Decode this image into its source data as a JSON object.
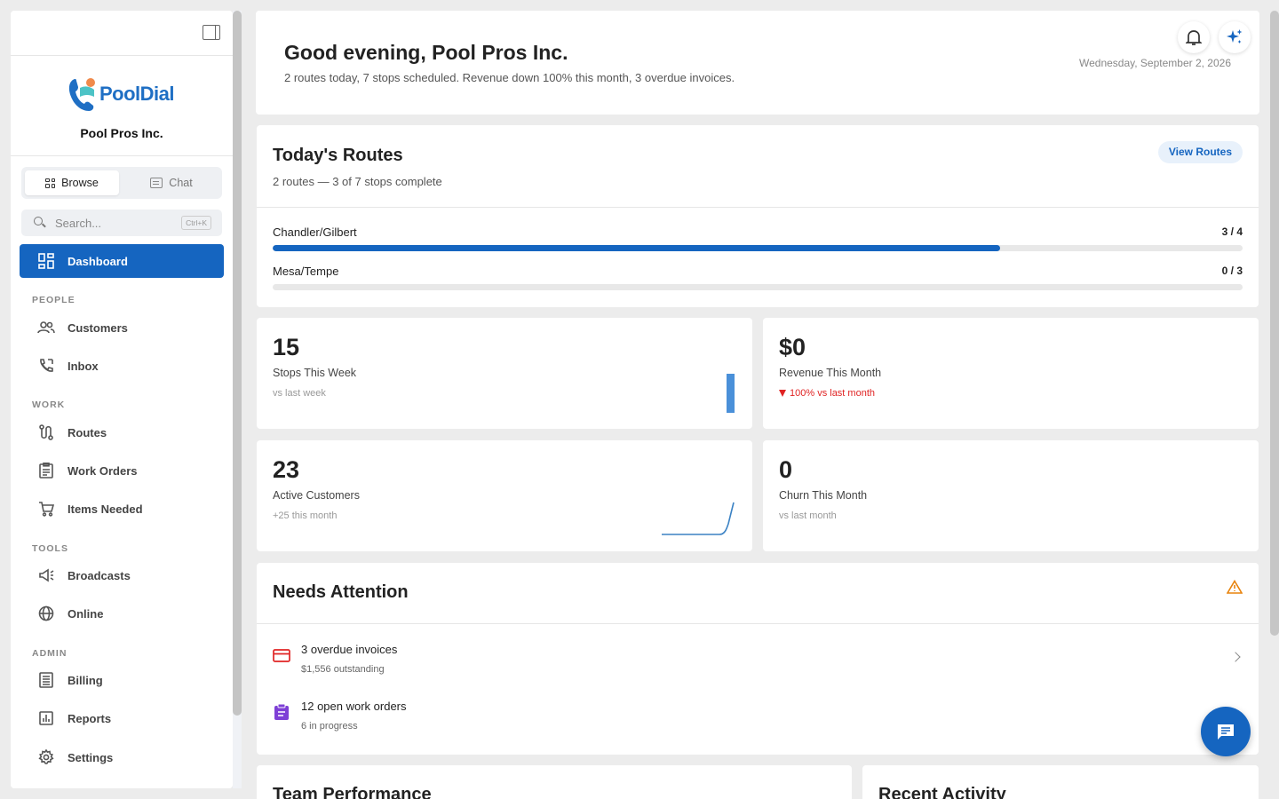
{
  "sidebar": {
    "brand_name": "PoolDial",
    "company": "Pool Pros Inc.",
    "modes": {
      "browse": "Browse",
      "chat": "Chat"
    },
    "search": {
      "placeholder": "Search...",
      "shortcut": "Ctrl+K"
    },
    "dashboard": "Dashboard",
    "sections": {
      "people": "PEOPLE",
      "work": "WORK",
      "tools": "TOOLS",
      "admin": "ADMIN"
    },
    "items": {
      "customers": "Customers",
      "inbox": "Inbox",
      "routes": "Routes",
      "work_orders": "Work Orders",
      "items_needed": "Items Needed",
      "broadcasts": "Broadcasts",
      "online": "Online",
      "billing": "Billing",
      "reports": "Reports",
      "settings": "Settings"
    }
  },
  "header": {
    "greeting": "Good evening, Pool Pros Inc.",
    "summary": "2 routes today, 7 stops scheduled. Revenue down 100% this month, 3 overdue invoices.",
    "date": "Wednesday, September 2, 2026"
  },
  "routes_card": {
    "title": "Today's Routes",
    "subtitle": "2 routes — 3 of 7 stops complete",
    "view_button": "View Routes",
    "routes": [
      {
        "name": "Chandler/Gilbert",
        "count": "3 / 4",
        "progress": 0.75
      },
      {
        "name": "Mesa/Tempe",
        "count": "0 / 3",
        "progress": 0
      }
    ]
  },
  "stats": {
    "stops": {
      "value": "15",
      "label": "Stops This Week",
      "note": "vs last week"
    },
    "revenue": {
      "value": "$0",
      "label": "Revenue This Month",
      "note": "100% vs last month"
    },
    "customers": {
      "value": "23",
      "label": "Active Customers",
      "note": "+25 this month"
    },
    "churn": {
      "value": "0",
      "label": "Churn This Month",
      "note": "vs last month"
    }
  },
  "attention": {
    "title": "Needs Attention",
    "items": [
      {
        "title": "3 overdue invoices",
        "sub": "$1,556 outstanding"
      },
      {
        "title": "12 open work orders",
        "sub": "6 in progress"
      }
    ]
  },
  "team": {
    "title": "Team Performance"
  },
  "activity": {
    "title": "Recent Activity"
  },
  "colors": {
    "primary": "#1565c0",
    "danger": "#e02424",
    "warning": "#e8830c",
    "purple": "#7e3fd6"
  }
}
